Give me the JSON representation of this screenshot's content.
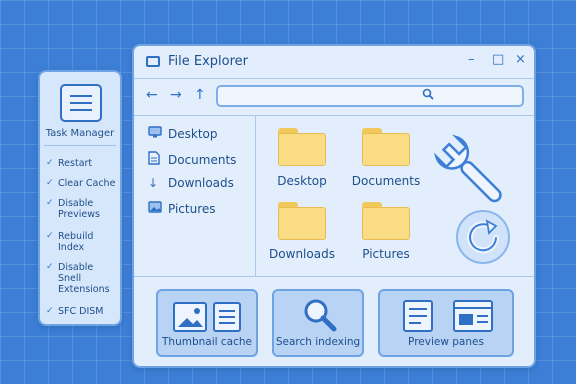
{
  "task_panel": {
    "title": "Task Manager",
    "items": [
      "Restart",
      "Clear Cache",
      "Disable Previews",
      "Rebuild Index",
      "Disable Snell Extensions",
      "SFC DISM"
    ]
  },
  "window": {
    "title": "File Explorer",
    "controls": [
      "–",
      "□",
      "×"
    ],
    "search_icon": "search-icon"
  },
  "sidebar": {
    "items": [
      {
        "label": "Desktop",
        "icon": "monitor-icon"
      },
      {
        "label": "Documents",
        "icon": "document-icon"
      },
      {
        "label": "Downloads",
        "icon": "download-arrow-icon"
      },
      {
        "label": "Pictures",
        "icon": "picture-icon"
      }
    ]
  },
  "folders": [
    "Desktop",
    "Documents",
    "Downloads",
    "Pictures"
  ],
  "bottom_tiles": [
    {
      "label": "Thumbnail cache",
      "icon": "thumbnail-icon"
    },
    {
      "label": "Search indexing",
      "icon": "magnifier-icon"
    },
    {
      "label": "Preview panes",
      "icon": "preview-pane-icon"
    }
  ],
  "colors": {
    "background": "#3d7fd6",
    "panel": "#d7e7fb",
    "accent": "#2f6fc4",
    "folder": "#f9dc83"
  }
}
